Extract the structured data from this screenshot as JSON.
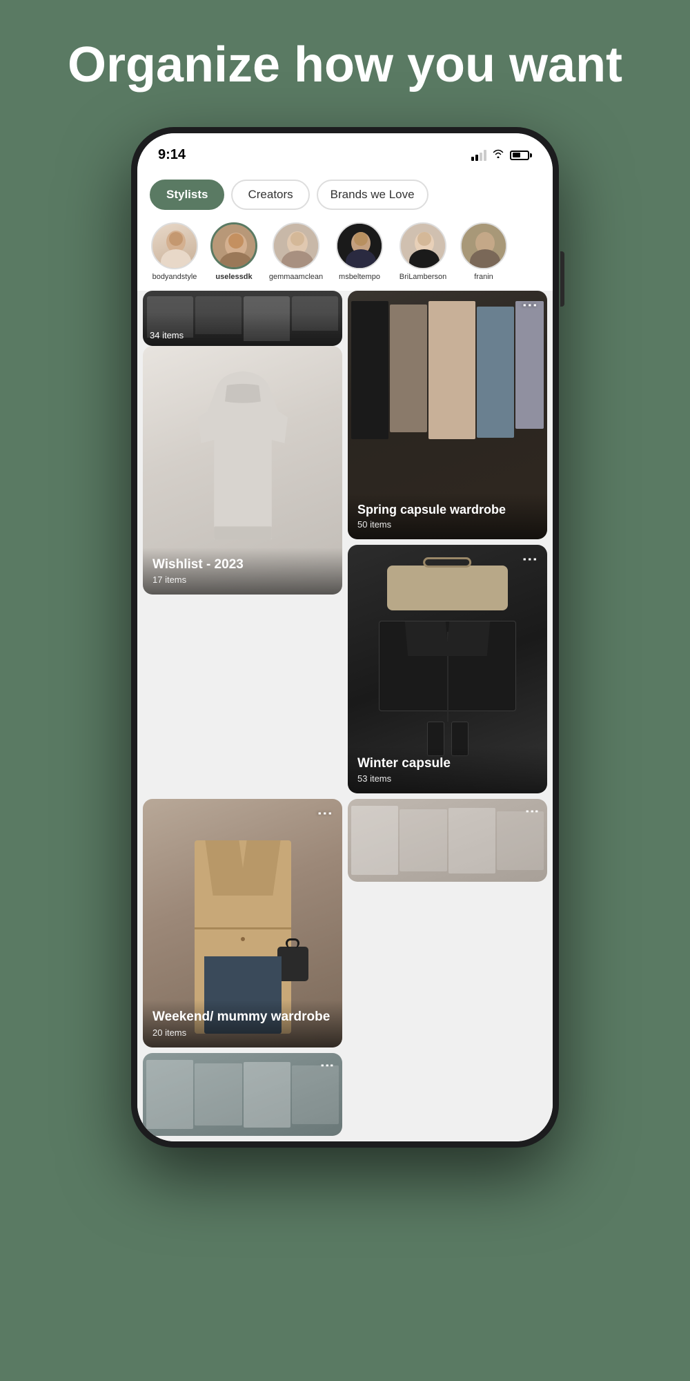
{
  "hero": {
    "title": "Organize how you want"
  },
  "status_bar": {
    "time": "9:14",
    "signal_label": "signal",
    "wifi_label": "wifi",
    "battery_label": "battery"
  },
  "tabs": [
    {
      "id": "stylists",
      "label": "Stylists",
      "active": true
    },
    {
      "id": "creators",
      "label": "Creators",
      "active": false
    },
    {
      "id": "brands",
      "label": "Brands we Love",
      "active": false
    }
  ],
  "creators": [
    {
      "id": "bodyandstyle",
      "name": "bodyandstyle",
      "selected": false
    },
    {
      "id": "uselessdk",
      "name": "uselessdk",
      "selected": true
    },
    {
      "id": "gemmaamclean",
      "name": "gemmaamclean",
      "selected": false
    },
    {
      "id": "msbeltempo",
      "name": "msbeltempo",
      "selected": false
    },
    {
      "id": "briLamberson",
      "name": "BriLamberson",
      "selected": false
    },
    {
      "id": "franin",
      "name": "franin",
      "selected": false
    }
  ],
  "cards": [
    {
      "id": "partial-top-left",
      "title": "",
      "subtitle": "34 items",
      "type": "partial",
      "position": "top-left"
    },
    {
      "id": "spring-capsule",
      "title": "Spring capsule wardrobe",
      "subtitle": "50 items",
      "type": "full",
      "has_menu": true
    },
    {
      "id": "wishlist-2023",
      "title": "Wishlist - 2023",
      "subtitle": "17 items",
      "type": "full",
      "has_menu": false
    },
    {
      "id": "winter-capsule",
      "title": "Winter capsule",
      "subtitle": "53 items",
      "type": "full",
      "has_menu": true
    },
    {
      "id": "weekend-mummy",
      "title": "Weekend/ mummy wardrobe",
      "subtitle": "20 items",
      "type": "full",
      "has_menu": true
    },
    {
      "id": "bottom-left",
      "title": "",
      "subtitle": "",
      "type": "partial-bottom",
      "has_menu": true
    },
    {
      "id": "bottom-right",
      "title": "",
      "subtitle": "",
      "type": "partial-bottom",
      "has_menu": true
    }
  ],
  "menu_dots": "⋮",
  "colors": {
    "background": "#5a7a63",
    "active_tab": "#5a7a63",
    "white": "#ffffff"
  }
}
